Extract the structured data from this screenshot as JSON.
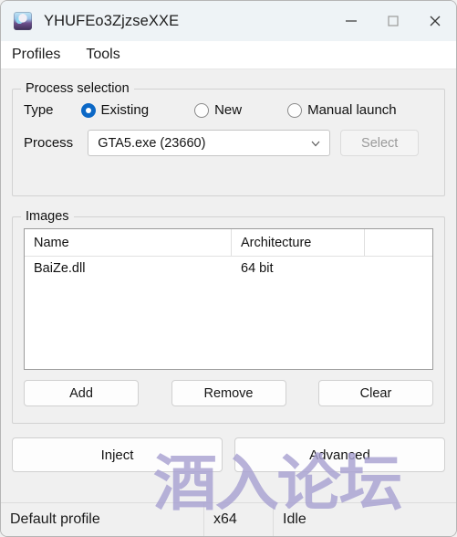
{
  "window": {
    "title": "YHUFEo3ZjzseXXE",
    "icon": "app-avatar-icon",
    "minimize_label": "—",
    "maximize_label": "□",
    "close_label": "✕"
  },
  "menubar": {
    "items": [
      {
        "label": "Profiles"
      },
      {
        "label": "Tools"
      }
    ]
  },
  "process_selection": {
    "group_title": "Process selection",
    "type_label": "Type",
    "type_options": [
      {
        "label": "Existing",
        "selected": true
      },
      {
        "label": "New",
        "selected": false
      },
      {
        "label": "Manual launch",
        "selected": false
      }
    ],
    "process_label": "Process",
    "process_value": "GTA5.exe (23660)",
    "select_button": "Select",
    "select_button_enabled": false
  },
  "images": {
    "group_title": "Images",
    "columns": [
      "Name",
      "Architecture",
      ""
    ],
    "rows": [
      {
        "name": "BaiZe.dll",
        "architecture": "64 bit",
        "extra": ""
      }
    ],
    "buttons": [
      {
        "label": "Add"
      },
      {
        "label": "Remove"
      },
      {
        "label": "Clear"
      }
    ]
  },
  "actions": {
    "inject_label": "Inject",
    "advanced_label": "Advanced"
  },
  "statusbar": {
    "profile": "Default profile",
    "architecture": "x64",
    "state": "Idle"
  },
  "watermark": {
    "text": "酒入论坛",
    "color": "#a9a2d2"
  },
  "colors": {
    "accent": "#0c68c6",
    "titlebar_bg": "#eef3f6",
    "window_bg": "#f0f0f0",
    "menubar_bg": "#ffffff"
  }
}
